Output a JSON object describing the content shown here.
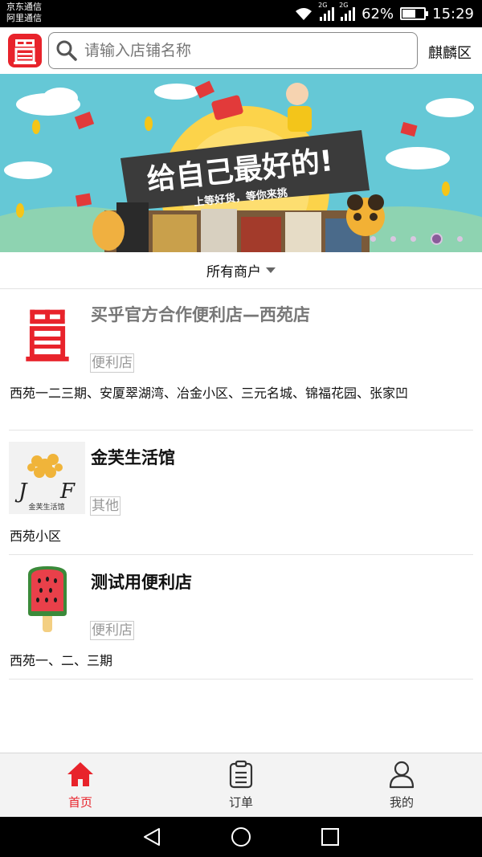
{
  "status_bar": {
    "carrier_1": "京东通信",
    "carrier_2": "阿里通信",
    "network_1": "2G",
    "network_2": "2G",
    "battery_percent": "62%",
    "battery_level": 0.62,
    "time": "15:29"
  },
  "header": {
    "logo_icon": "mai-logo-icon",
    "search_placeholder": "请输入店铺名称",
    "region": "麒麟区"
  },
  "banner": {
    "headline": "给自己最好的!",
    "subline": "上等好货，等你来挑",
    "active_slide": 4,
    "slide_count": 5
  },
  "filter": {
    "label": "所有商户"
  },
  "stores": [
    {
      "name": "买乎官方合作便利店—西苑店",
      "category": "便利店",
      "areas": "西苑一二三期、安厦翠湖湾、冶金小区、三元名城、锦福花园、张家凹",
      "thumb": "mai-logo-icon"
    },
    {
      "name": "金芙生活馆",
      "category": "其他",
      "areas": "西苑小区",
      "thumb": "jinfu-logo",
      "logo_text": "金芙生活馆"
    },
    {
      "name": "测试用便利店",
      "category": "便利店",
      "areas": "西苑一、二、三期",
      "thumb": "watermelon-popsicle-icon"
    }
  ],
  "tabbar": {
    "tabs": [
      {
        "label": "首页",
        "icon": "home-icon",
        "active": true
      },
      {
        "label": "订单",
        "icon": "clipboard-icon",
        "active": false
      },
      {
        "label": "我的",
        "icon": "person-icon",
        "active": false
      }
    ],
    "active_color": "#e8232b",
    "inactive_color": "#333333"
  },
  "colors": {
    "brand": "#e8232b",
    "banner_sky": "#65c8d6"
  }
}
